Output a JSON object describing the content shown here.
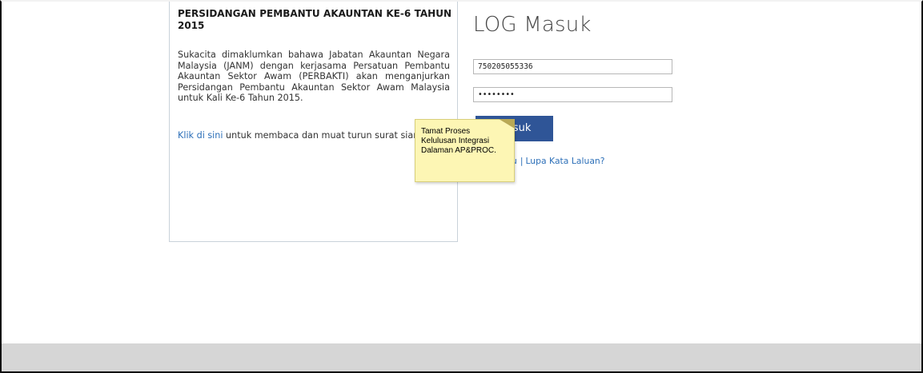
{
  "news": {
    "title": "PERSIDANGAN PEMBANTU AKAUNTAN KE-6 TAHUN 2015",
    "body": "Sukacita dimaklumkan bahawa Jabatan Akauntan Negara Malaysia (JANM) dengan kerjasama Persatuan Pembantu Akauntan Sektor Awam (PERBAKTI) akan menganjurkan Persidangan Pembantu Akauntan Sektor Awam Malaysia untuk Kali Ke-6 Tahun 2015.",
    "link_label": "Klik di sini",
    "link_suffix": " untuk membaca dan muat turun surat siar"
  },
  "login": {
    "title": "LOG Masuk",
    "username_value": "750205055336",
    "password_value": "••••••••",
    "button_label": "Masuk",
    "link_partial": "u",
    "separator": "|",
    "forgot_label": "Lupa Kata Laluan?"
  },
  "tooltip": {
    "line1": "Tamat Proses",
    "line2": "Kelulusan Integrasi",
    "line3": "Dalaman AP&PROC."
  },
  "colors": {
    "button_bg": "#2f5597",
    "link": "#2c6fb8",
    "tooltip_bg": "#fdf6b4",
    "footer_band": "#d6d6d6"
  }
}
